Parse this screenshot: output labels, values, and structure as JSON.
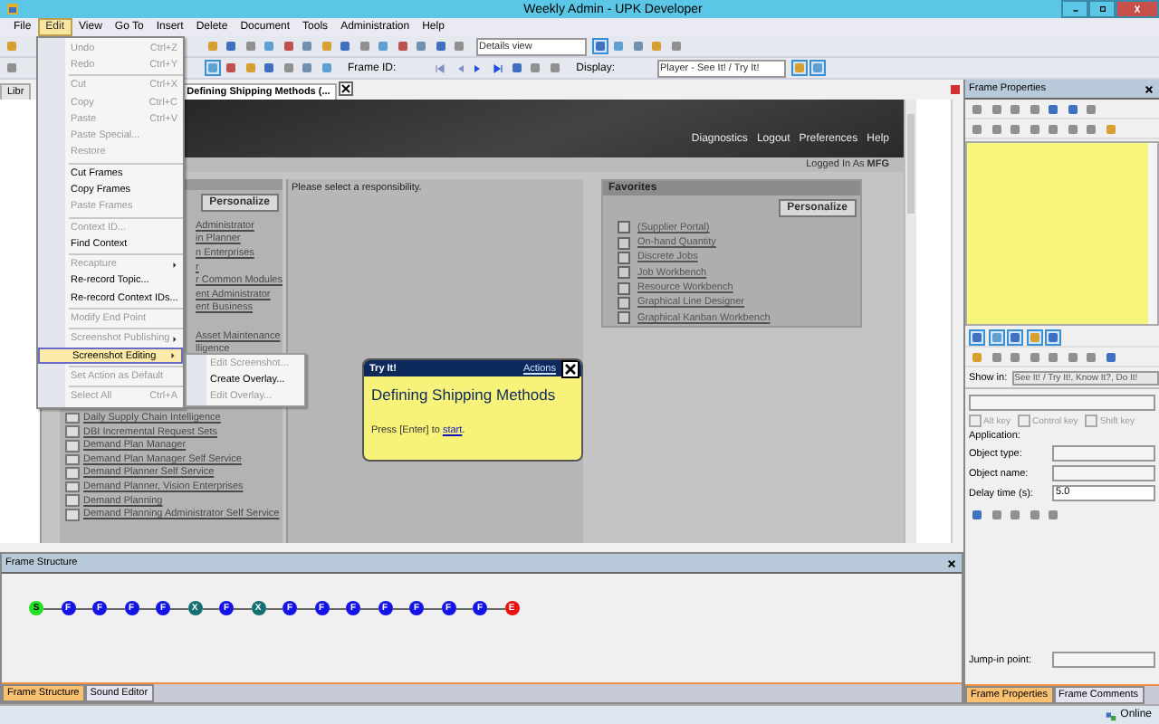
{
  "window": {
    "title": "Weekly Admin - UPK Developer"
  },
  "menu_bar": [
    {
      "label": "File",
      "selected": false
    },
    {
      "label": "Edit",
      "selected": true
    },
    {
      "label": "View",
      "selected": false
    },
    {
      "label": "Go To",
      "selected": false
    },
    {
      "label": "Insert",
      "selected": false
    },
    {
      "label": "Delete",
      "selected": false
    },
    {
      "label": "Document",
      "selected": false
    },
    {
      "label": "Tools",
      "selected": false
    },
    {
      "label": "Administration",
      "selected": false
    },
    {
      "label": "Help",
      "selected": false
    }
  ],
  "edit_menu": [
    {
      "kind": "item",
      "label": "Undo",
      "shortcut": "Ctrl+Z",
      "disabled": true,
      "selected": false
    },
    {
      "kind": "item",
      "label": "Redo",
      "shortcut": "Ctrl+Y",
      "disabled": true,
      "selected": false
    },
    {
      "kind": "separator"
    },
    {
      "kind": "item",
      "label": "Cut",
      "shortcut": "Ctrl+X",
      "disabled": true,
      "selected": false
    },
    {
      "kind": "item",
      "label": "Copy",
      "shortcut": "Ctrl+C",
      "disabled": true,
      "selected": false
    },
    {
      "kind": "item",
      "label": "Paste",
      "shortcut": "Ctrl+V",
      "disabled": true,
      "selected": false
    },
    {
      "kind": "item",
      "label": "Paste Special...",
      "disabled": true,
      "selected": false
    },
    {
      "kind": "item",
      "label": "Restore",
      "disabled": true,
      "selected": false
    },
    {
      "kind": "separator"
    },
    {
      "kind": "item",
      "label": "Cut Frames",
      "disabled": false,
      "selected": false
    },
    {
      "kind": "item",
      "label": "Copy Frames",
      "disabled": false,
      "selected": false
    },
    {
      "kind": "item",
      "label": "Paste Frames",
      "disabled": true,
      "selected": false
    },
    {
      "kind": "separator"
    },
    {
      "kind": "item",
      "label": "Context ID...",
      "disabled": true,
      "selected": false
    },
    {
      "kind": "item",
      "label": "Find Context",
      "disabled": false,
      "selected": false
    },
    {
      "kind": "separator"
    },
    {
      "kind": "submenu",
      "label": "Recapture",
      "disabled": true,
      "selected": false
    },
    {
      "kind": "item",
      "label": "Re-record Topic...",
      "disabled": false,
      "selected": false
    },
    {
      "kind": "item",
      "label": "Re-record Context IDs...",
      "disabled": false,
      "selected": false
    },
    {
      "kind": "separator"
    },
    {
      "kind": "item",
      "label": "Modify End Point",
      "disabled": true,
      "selected": false
    },
    {
      "kind": "separator"
    },
    {
      "kind": "submenu",
      "label": "Screenshot Publishing",
      "disabled": true,
      "selected": false
    },
    {
      "kind": "submenu",
      "label": "Screenshot Editing",
      "disabled": false,
      "selected": true
    },
    {
      "kind": "separator"
    },
    {
      "kind": "item",
      "label": "Set Action as Default",
      "disabled": true,
      "selected": false
    },
    {
      "kind": "separator"
    },
    {
      "kind": "item",
      "label": "Select All",
      "shortcut": "Ctrl+A",
      "disabled": true,
      "selected": false
    }
  ],
  "submenu": [
    {
      "label": "Edit Screenshot...",
      "disabled": true
    },
    {
      "label": "Create Overlay...",
      "disabled": false
    },
    {
      "label": "Edit Overlay...",
      "disabled": true
    }
  ],
  "toolbar": {
    "details_view": "Details view",
    "frame_id_label": "Frame ID:",
    "display_label": "Display:",
    "display_value": "Player - See It! / Try It!"
  },
  "document_tabs": [
    {
      "label": "Libr",
      "selected": false
    },
    {
      "label": "Defining Shipping Methods (...",
      "selected": true
    }
  ],
  "screenshot": {
    "header_links": [
      "Diagnostics",
      "Logout",
      "Preferences",
      "Help"
    ],
    "logged_in": "Logged In As **MFG**",
    "left_button": "Personalize",
    "list": [
      {
        "kind": "partial",
        "text": "Administrator"
      },
      {
        "kind": "partial",
        "text": "in Planner"
      },
      {
        "kind": "partial",
        "text": "n Enterprises"
      },
      {
        "kind": "partial",
        "text": "r"
      },
      {
        "kind": "partial",
        "text": "r Common Modules"
      },
      {
        "kind": "partial",
        "text": "ent Administrator"
      },
      {
        "kind": "partial",
        "text": "ent Business"
      },
      {
        "kind": "hidden"
      },
      {
        "kind": "partial",
        "text": "Asset Maintenance"
      },
      {
        "kind": "partial",
        "text": "lligence"
      },
      {
        "kind": "hidden"
      },
      {
        "kind": "hidden"
      },
      {
        "kind": "hidden"
      },
      {
        "kind": "hidden"
      },
      {
        "kind": "full",
        "text": "Daily Supply Chain Intelligence"
      },
      {
        "kind": "full",
        "text": "DBI Incremental Request Sets"
      },
      {
        "kind": "full",
        "text": "Demand Plan Manager"
      },
      {
        "kind": "full",
        "text": "Demand Plan Manager Self Service"
      },
      {
        "kind": "full",
        "text": "Demand Planner Self Service"
      },
      {
        "kind": "full",
        "text": "Demand Planner, Vision Enterprises"
      },
      {
        "kind": "full",
        "text": "Demand Planning"
      },
      {
        "kind": "full",
        "text": "Demand Planning Administrator Self Service"
      }
    ],
    "message": "Please select a responsibility.",
    "favorites": {
      "title": "Favorites",
      "button": "Personalize",
      "links": [
        "(Supplier Portal)",
        "On-hand Quantity",
        "Discrete Jobs",
        "Job Workbench",
        "Resource Workbench",
        "Graphical Line Designer",
        "Graphical Kanban Workbench"
      ]
    }
  },
  "bubble": {
    "header": "Try It!",
    "actions": "Actions",
    "title": "Defining Shipping Methods",
    "prompt": "Press [Enter] to",
    "link": "start",
    "end": "."
  },
  "frame_properties": {
    "title": "Frame Properties",
    "show_in_label": "Show in:",
    "show_in_value": "See It! / Try It!, Know It?, Do It!",
    "checkboxes": [
      {
        "label": "Alt key",
        "checked": false,
        "disabled": true
      },
      {
        "label": "Control key",
        "checked": false,
        "disabled": true
      },
      {
        "label": "Shift key",
        "checked": false,
        "disabled": true
      }
    ],
    "application_label": "Application:",
    "fields": [
      {
        "kind": "dropdown",
        "label": "Object type:"
      },
      {
        "kind": "text",
        "label": "Object name:"
      },
      {
        "kind": "dropdown",
        "label": "Delay time (s):",
        "value": "5.0"
      }
    ],
    "jump_in_label": "Jump-in point:",
    "tabs": [
      {
        "label": "Frame Properties",
        "selected": true
      },
      {
        "label": "Frame Comments",
        "selected": false
      }
    ]
  },
  "frame_structure": {
    "title": "Frame Structure",
    "nodes": [
      {
        "kind": "start",
        "label": "S"
      },
      {
        "kind": "frame",
        "label": "F"
      },
      {
        "kind": "frame",
        "label": "F"
      },
      {
        "kind": "frame",
        "label": "F"
      },
      {
        "kind": "frame",
        "label": "F"
      },
      {
        "kind": "decision",
        "label": "X"
      },
      {
        "kind": "frame",
        "label": "F"
      },
      {
        "kind": "decision",
        "label": "X"
      },
      {
        "kind": "frame",
        "label": "F"
      },
      {
        "kind": "frame",
        "label": "F"
      },
      {
        "kind": "frame",
        "label": "F"
      },
      {
        "kind": "frame",
        "label": "F"
      },
      {
        "kind": "frame",
        "label": "F"
      },
      {
        "kind": "frame",
        "label": "F"
      },
      {
        "kind": "frame",
        "label": "F"
      },
      {
        "kind": "end",
        "label": "E"
      }
    ],
    "tabs": [
      {
        "label": "Frame Structure",
        "selected": true
      },
      {
        "label": "Sound Editor",
        "selected": false
      }
    ]
  },
  "status_bar": {
    "status": "Online"
  }
}
